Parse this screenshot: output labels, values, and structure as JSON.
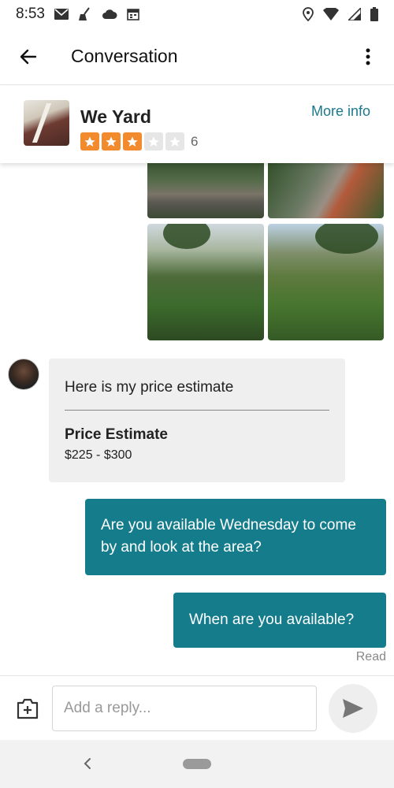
{
  "status_bar": {
    "time": "8:53",
    "left_icons": [
      "mail-icon",
      "broom-icon",
      "cloud-icon",
      "calendar-icon"
    ],
    "right_icons": [
      "location-icon",
      "wifi-icon",
      "signal-icon",
      "battery-icon"
    ]
  },
  "app_bar": {
    "title": "Conversation",
    "back_icon": "arrow-left-icon",
    "menu_icon": "more-vert-icon"
  },
  "listing": {
    "name": "We Yard",
    "rating": 3,
    "rating_max": 5,
    "review_count": "6",
    "more_info_label": "More info"
  },
  "messages": {
    "incoming": {
      "text": "Here is my price estimate",
      "estimate_title": "Price Estimate",
      "estimate_range": "$225 - $300"
    },
    "outgoing": [
      {
        "text": "Are you available Wednesday to come by and look at the area?"
      },
      {
        "text": "When are you available?"
      }
    ],
    "read_status": "Read"
  },
  "reply": {
    "placeholder": "Add a reply..."
  },
  "colors": {
    "accent": "#157c8c",
    "link": "#1a7a8c",
    "star_on": "#f28a2e",
    "star_off": "#e6e6e6",
    "incoming_bubble": "#efefef"
  }
}
